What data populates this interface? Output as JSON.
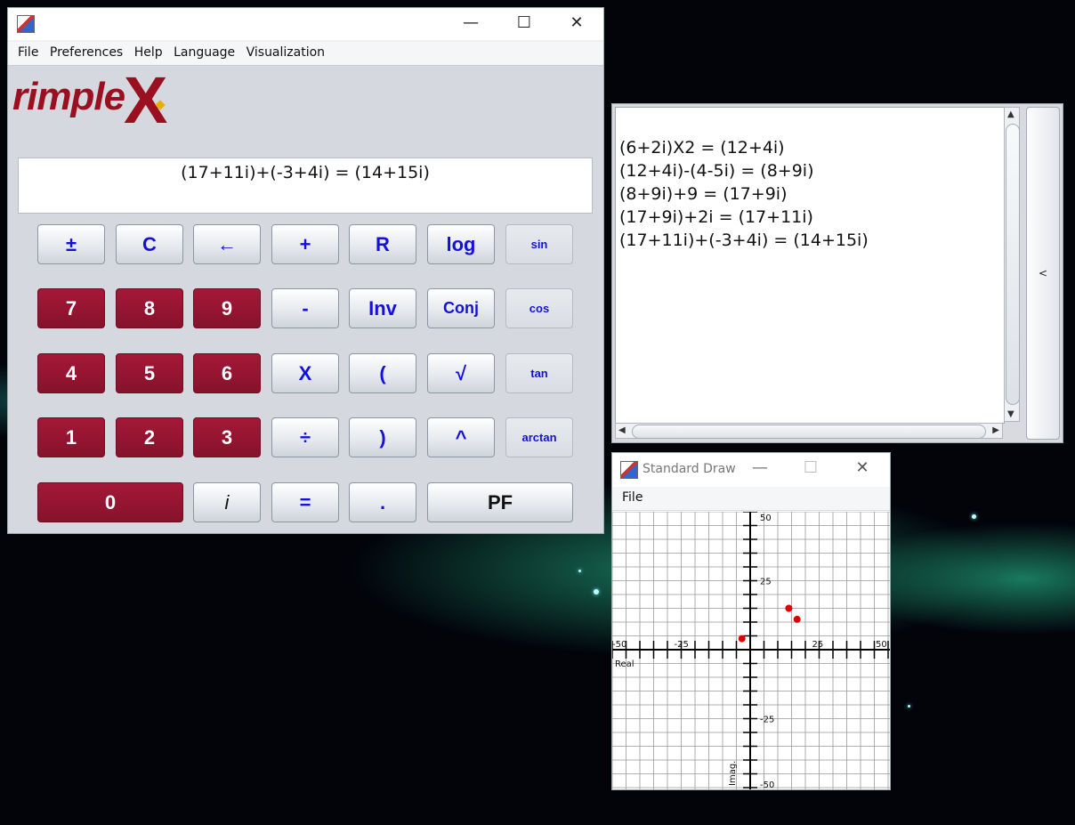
{
  "calculator": {
    "menu": [
      "File",
      "Preferences",
      "Help",
      "Language",
      "Visualization"
    ],
    "logo": "rimpleX",
    "display": "(17+11i)+(-3+4i) = (14+15i)",
    "keys": [
      [
        "±",
        "C",
        "←",
        "+",
        "R",
        "log",
        "sin"
      ],
      [
        "7",
        "8",
        "9",
        "-",
        "Inv",
        "Conj",
        "cos"
      ],
      [
        "4",
        "5",
        "6",
        "X",
        "(",
        "√",
        "tan"
      ],
      [
        "1",
        "2",
        "3",
        "÷",
        ")",
        "^",
        "arctan"
      ],
      [
        "0",
        "i",
        "=",
        ".",
        "PF"
      ]
    ],
    "window_controls": [
      "—",
      "☐",
      "✕"
    ]
  },
  "history": {
    "lines": [
      "(6+2i)X2 = (12+4i)",
      "(12+4i)-(4-5i) = (8+9i)",
      "(8+9i)+9 = (17+9i)",
      "(17+9i)+2i = (17+11i)",
      "(17+11i)+(-3+4i) = (14+15i)"
    ],
    "side_button": "<"
  },
  "standard_draw": {
    "title": "Standard Draw",
    "menu": [
      "File"
    ],
    "window_controls": [
      "—",
      "☐",
      "✕"
    ]
  },
  "chart_data": {
    "type": "scatter",
    "xlabel": "Real",
    "ylabel": "Imag.",
    "xlim": [
      -50,
      50
    ],
    "ylim": [
      -50,
      50
    ],
    "x_ticks": [
      "-50",
      "-25",
      "25",
      "50"
    ],
    "y_ticks": [
      "50",
      "25",
      "-25",
      "-50"
    ],
    "grid": true,
    "points": [
      {
        "x": -3,
        "y": 4
      },
      {
        "x": 14,
        "y": 15
      },
      {
        "x": 17,
        "y": 11
      }
    ],
    "point_color": "#e00000"
  }
}
